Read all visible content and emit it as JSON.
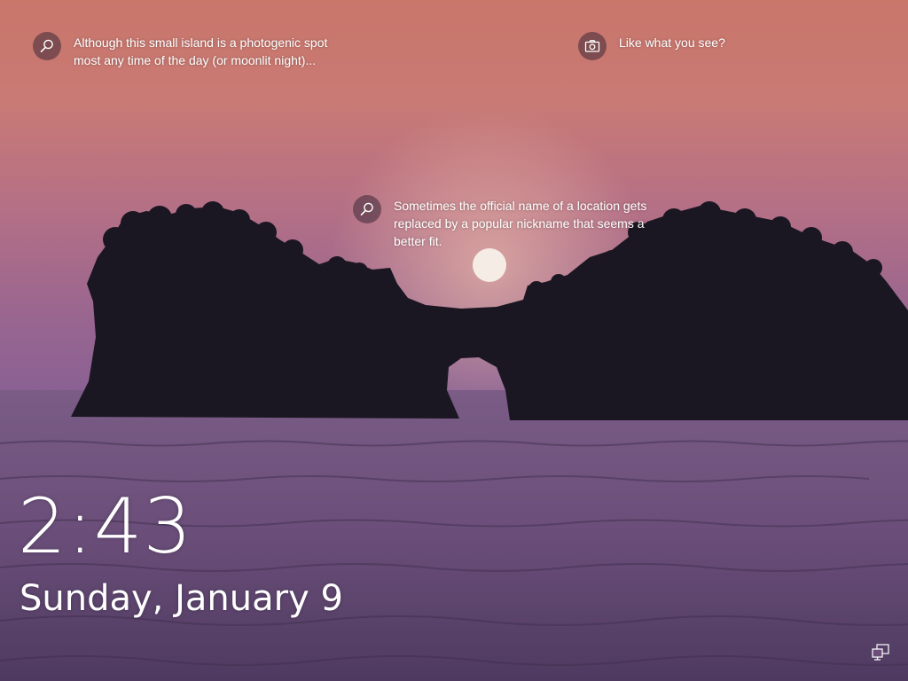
{
  "hotspots": [
    {
      "icon": "search-icon",
      "text": "Although this small island is a photogenic spot most any time of the day (or moonlit night)..."
    },
    {
      "icon": "camera-icon",
      "text": "Like what you see?"
    },
    {
      "icon": "search-icon",
      "text": "Sometimes the official name of a location gets replaced by a popular nickname that seems a better fit."
    }
  ],
  "lock": {
    "time": "2:43",
    "date": "Sunday, January 9"
  },
  "status": {
    "network_icon": "network-icon"
  }
}
